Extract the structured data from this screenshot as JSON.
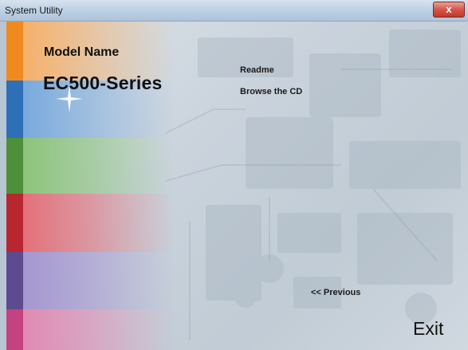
{
  "window": {
    "title": "System Utility",
    "close_label": "x"
  },
  "header": {
    "label": "Model Name",
    "model": "EC500-Series"
  },
  "menu": {
    "items": [
      "Readme",
      "Browse the CD"
    ]
  },
  "nav": {
    "previous": "<< Previous",
    "exit": "Exit"
  },
  "colors": {
    "orange": "#f08a1e",
    "blue": "#2e6fb8",
    "green": "#4f8f3a",
    "red": "#b8262f",
    "purple": "#5d4a8f",
    "magenta": "#c4427f"
  }
}
